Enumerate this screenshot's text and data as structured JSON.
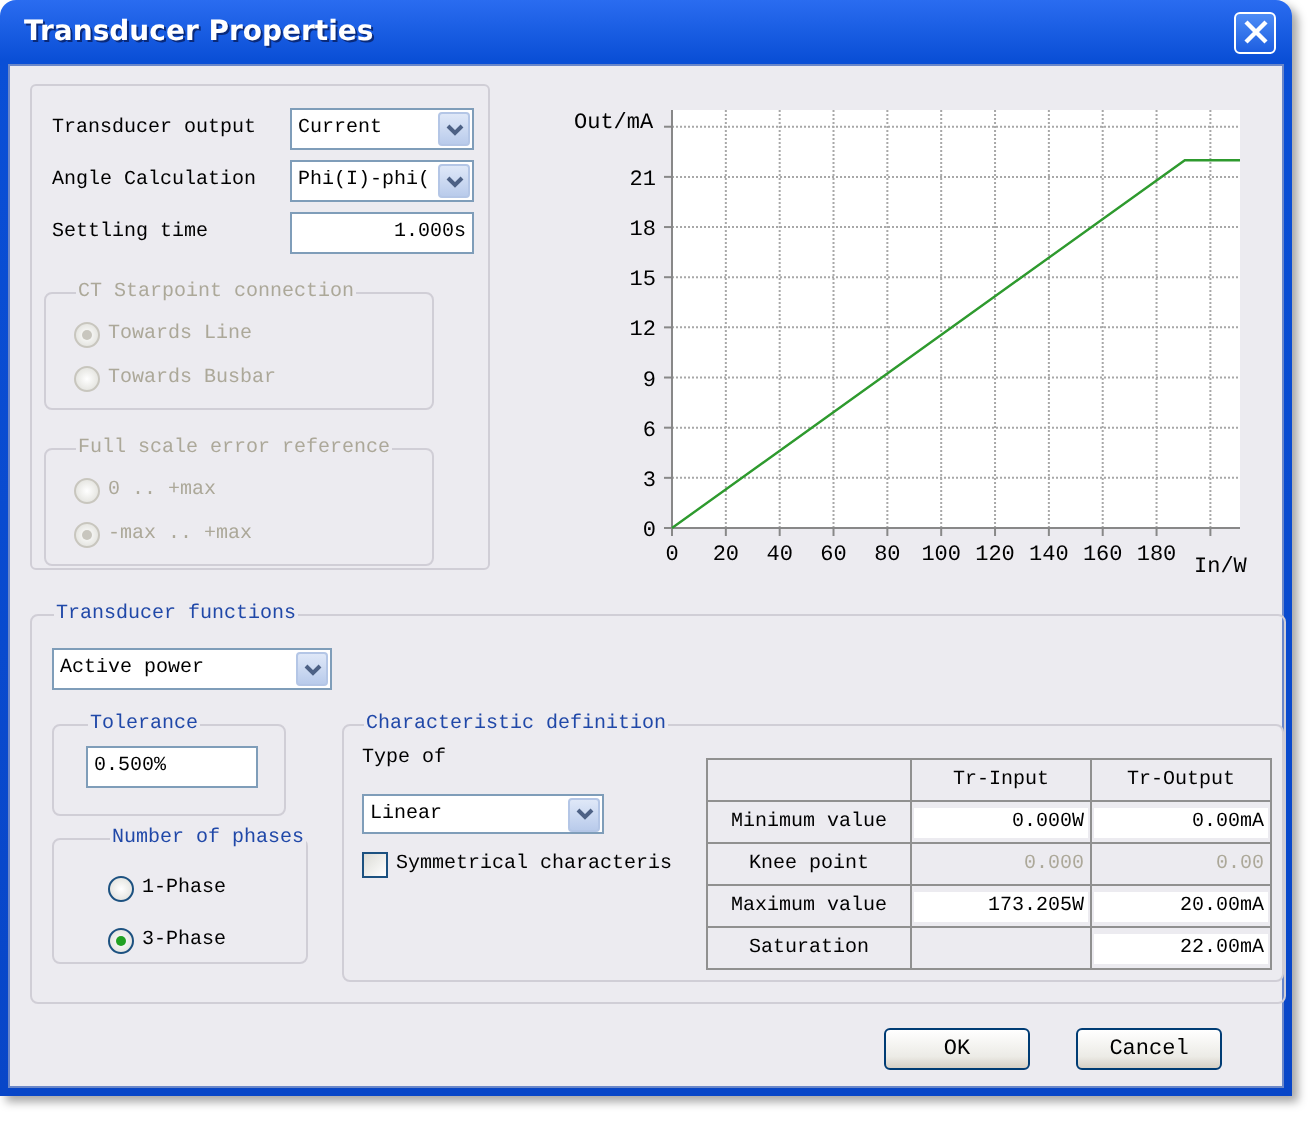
{
  "window": {
    "title": "Transducer Properties"
  },
  "general": {
    "fields": [
      {
        "kind": "select",
        "label": "Transducer output",
        "value": "Current"
      },
      {
        "kind": "select",
        "label": "Angle Calculation",
        "value": "Phi(I)-phi("
      },
      {
        "kind": "input",
        "label": "Settling time",
        "value": "1.000s"
      }
    ],
    "groups": [
      {
        "title": "CT Starpoint connection",
        "disabled": true,
        "options": [
          {
            "label": "Towards Line",
            "selected": true
          },
          {
            "label": "Towards Busbar",
            "selected": false
          }
        ]
      },
      {
        "title": "Full scale error reference",
        "disabled": true,
        "options": [
          {
            "label": "0 .. +max",
            "selected": false
          },
          {
            "label": "-max .. +max",
            "selected": true
          }
        ]
      }
    ]
  },
  "chart": {
    "chart_data": {
      "type": "line",
      "xlabel": "In/W",
      "ylabel": "Out/mA",
      "x": [
        0,
        190.5,
        211
      ],
      "series": [
        {
          "color": "#2e9a2e",
          "values": [
            0,
            22,
            22
          ]
        }
      ],
      "grid": true,
      "xlim": [
        0,
        211
      ],
      "ylim": [
        0,
        25
      ],
      "xticks": [
        0,
        20,
        40,
        60,
        80,
        100,
        120,
        140,
        160,
        180
      ],
      "yticks": [
        0,
        3,
        6,
        9,
        12,
        15,
        18,
        21
      ]
    }
  },
  "functions": {
    "title": "Transducer functions",
    "select": "Active power",
    "tolerance": {
      "title": "Tolerance",
      "value": "0.500%"
    },
    "phases": {
      "title": "Number of phases",
      "options": [
        {
          "label": "1-Phase",
          "selected": false
        },
        {
          "label": "3-Phase",
          "selected": true
        }
      ]
    },
    "characteristic": {
      "title": "Characteristic definition",
      "type_label": "Type of",
      "type_value": "Linear",
      "symmetric": {
        "label": "Symmetrical characteris",
        "checked": false
      },
      "table": {
        "columns": [
          "Tr-Input",
          "Tr-Output"
        ],
        "rows": [
          {
            "label": "Minimum value",
            "cells": [
              {
                "kind": "field",
                "value": "0.000W",
                "disabled": false
              },
              {
                "kind": "field",
                "value": "0.00mA",
                "disabled": false
              }
            ]
          },
          {
            "label": "Knee point",
            "cells": [
              {
                "kind": "field",
                "value": "0.000",
                "disabled": true
              },
              {
                "kind": "field",
                "value": "0.00",
                "disabled": true
              }
            ]
          },
          {
            "label": "Maximum value",
            "cells": [
              {
                "kind": "field",
                "value": "173.205W",
                "disabled": false
              },
              {
                "kind": "field",
                "value": "20.00mA",
                "disabled": false
              }
            ]
          },
          {
            "label": "Saturation",
            "cells": [
              {
                "kind": "blank"
              },
              {
                "kind": "field",
                "value": "22.00mA",
                "disabled": false
              }
            ]
          }
        ]
      }
    }
  },
  "buttons": [
    {
      "label": "OK"
    },
    {
      "label": "Cancel"
    }
  ]
}
